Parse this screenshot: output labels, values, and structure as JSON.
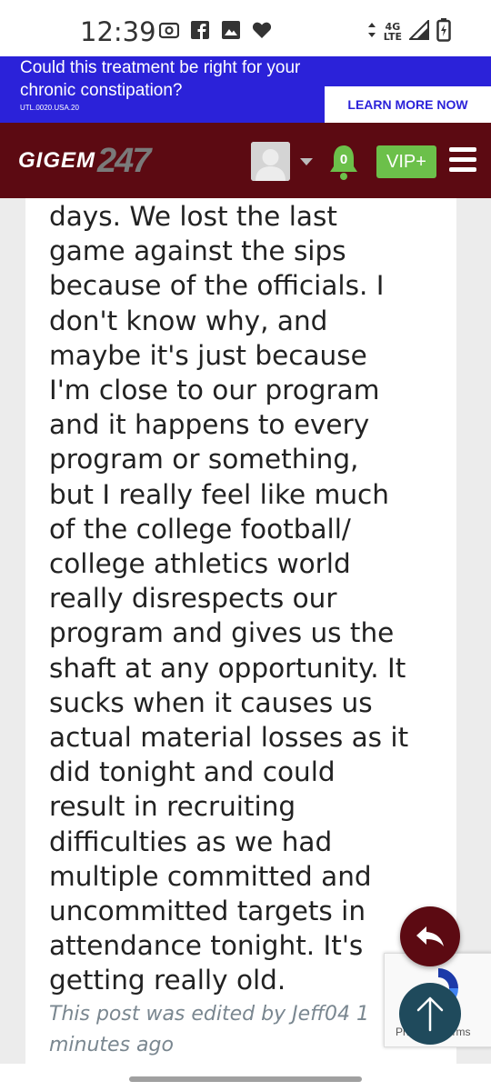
{
  "status_bar": {
    "time": "12:39",
    "network": "4G",
    "network_sub": "LTE",
    "left_icons": [
      "camera-icon",
      "facebook-icon",
      "image-icon",
      "heart-icon"
    ],
    "right_icons": [
      "data-arrows-icon",
      "signal-icon",
      "battery-charging-icon"
    ]
  },
  "ad": {
    "headline": "Could this treatment be right for your chronic constipation?",
    "code": "UTL.0020.USA.20",
    "cta": "LEARN MORE NOW",
    "bg_color": "#2b22d9"
  },
  "header": {
    "logo_text": "GIGEM",
    "logo_num": "247",
    "notification_count": "0",
    "vip_label": "VIP+",
    "bg_color": "#5c0a12"
  },
  "post": {
    "body": "days. We lost the last\ngame against the sips\nbecause of the officials. I\ndon't know why, and\nmaybe it's just because\nI'm close to our program\nand it happens to every\nprogram or something,\nbut I really feel like much\nof the college football/\ncollege athletics world\nreally disrespects our\nprogram and gives us the\nshaft at any opportunity. It\nsucks when it causes us\nactual material losses as it\ndid tonight and could\nresult in recruiting\ndifficulties as we had\nmultiple committed and\nuncommitted targets in\nattendance tonight. It's\ngetting really old.",
    "edited_note": "This post was edited by Jeff04 1\nminutes ago"
  },
  "recaptcha": {
    "text": "Privacy - Terms"
  },
  "fabs": {
    "reply_icon": "reply-icon",
    "scroll_top_icon": "arrow-up-icon"
  }
}
